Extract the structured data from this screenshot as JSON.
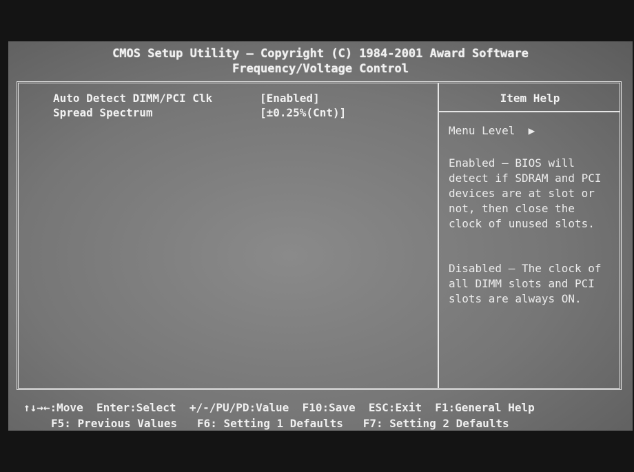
{
  "header": {
    "line1": "CMOS Setup Utility – Copyright (C) 1984-2001 Award Software",
    "line2": "Frequency/Voltage Control"
  },
  "items": [
    {
      "label": "Auto Detect DIMM/PCI Clk",
      "value": "[Enabled]"
    },
    {
      "label": "Spread Spectrum",
      "value": "[±0.25%(Cnt)]"
    }
  ],
  "help": {
    "title": "Item Help",
    "menu_level": "Menu Level  ▶",
    "paragraph1": "Enabled – BIOS will detect if SDRAM and PCI devices are at slot or not, then close the clock of unused slots.",
    "paragraph2": "Disabled – The clock of all DIMM slots and PCI slots are always ON."
  },
  "footer": {
    "line1": "↑↓→←:Move  Enter:Select  +/-/PU/PD:Value  F10:Save  ESC:Exit  F1:General Help",
    "line2": "F5: Previous Values   F6: Setting 1 Defaults   F7: Setting 2 Defaults"
  }
}
